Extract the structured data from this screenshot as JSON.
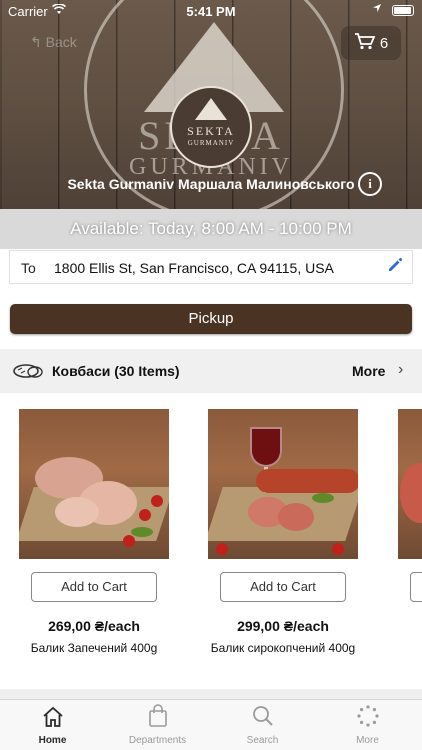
{
  "status_bar": {
    "carrier": "Carrier",
    "time": "5:41 PM"
  },
  "header": {
    "back_label": "Back",
    "cart_count": "6",
    "store_name": "Sekta Gurmaniv Маршала Малиновського",
    "hero_text_line1": "SEKTA",
    "hero_text_line2": "GURMANIV",
    "logo_line1": "SEKTA",
    "logo_line2": "GURMANIV"
  },
  "availability": "Available: Today, 8:00 AM - 10:00 PM",
  "address": {
    "to_label": "To",
    "value": "1800 Ellis St, San Francisco, CA 94115, USA"
  },
  "pickup_label": "Pickup",
  "section": {
    "title": "Ковбаси (30 Items)",
    "more_label": "More"
  },
  "products": [
    {
      "add_label": "Add to Cart",
      "price": "269,00 ₴/each",
      "name": "Балик Запечений 400g"
    },
    {
      "add_label": "Add to Cart",
      "price": "299,00 ₴/each",
      "name": "Балик сирокопчений 400g"
    }
  ],
  "tabs": [
    {
      "label": "Home",
      "icon": "home-icon",
      "active": true
    },
    {
      "label": "Departments",
      "icon": "bag-icon",
      "active": false
    },
    {
      "label": "Search",
      "icon": "search-icon",
      "active": false
    },
    {
      "label": "More",
      "icon": "more-icon",
      "active": false
    }
  ],
  "colors": {
    "accent": "#4b3324",
    "edit_blue": "#2a6bd6",
    "availability_bg": "#d9d9d9"
  }
}
